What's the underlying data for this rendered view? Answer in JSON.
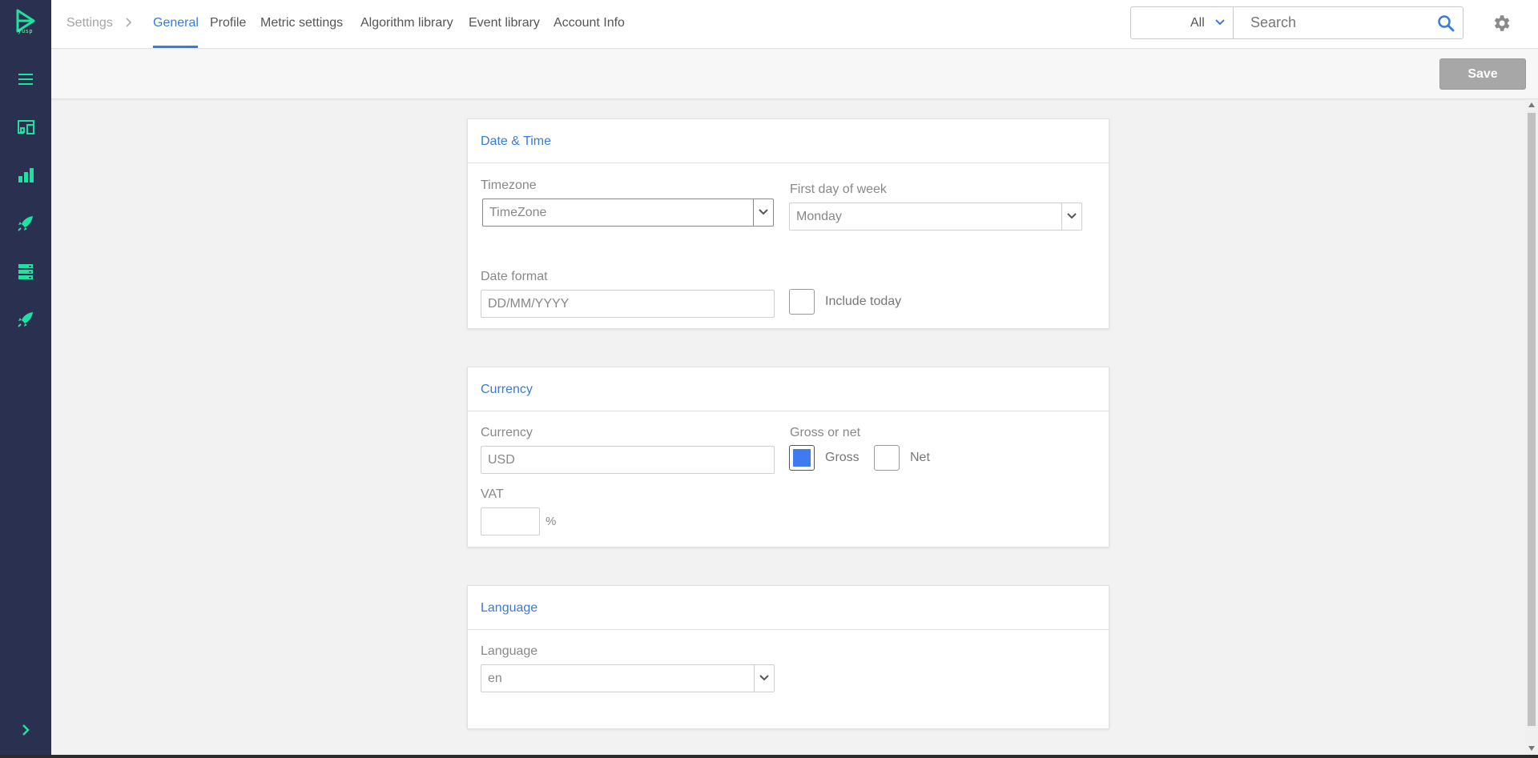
{
  "brand": {
    "logo_text": "yusp",
    "accent": "#3a7bd5",
    "sidebar_bg": "#2a3150",
    "sidebar_icon_color": "#1ee3a0"
  },
  "sidebar": {
    "items": [
      {
        "name": "menu-icon"
      },
      {
        "name": "devices-icon"
      },
      {
        "name": "bar-chart-icon"
      },
      {
        "name": "rocket-icon"
      },
      {
        "name": "server-list-icon"
      },
      {
        "name": "rocket-icon"
      }
    ],
    "expand_icon": "chevron-right-icon"
  },
  "topbar": {
    "breadcrumb": "Settings",
    "tabs": [
      {
        "label": "General",
        "active": true
      },
      {
        "label": "Profile",
        "active": false
      },
      {
        "label": "Metric settings",
        "active": false
      },
      {
        "label": "Algorithm library",
        "active": false
      },
      {
        "label": "Event library",
        "active": false
      },
      {
        "label": "Account Info",
        "active": false
      }
    ],
    "search": {
      "scope": "All",
      "placeholder": "Search"
    }
  },
  "toolbar": {
    "save_label": "Save"
  },
  "datetime": {
    "title": "Date & Time",
    "timezone_label": "Timezone",
    "timezone_value": "TimeZone",
    "first_day_label": "First day of week",
    "first_day_value": "Monday",
    "date_format_label": "Date format",
    "date_format_placeholder": "DD/MM/YYYY",
    "include_today_label": "Include today",
    "include_today_checked": false
  },
  "currency": {
    "title": "Currency",
    "currency_label": "Currency",
    "currency_value": "USD",
    "gross_net_label": "Gross or net",
    "gross_label": "Gross",
    "gross_checked": true,
    "net_label": "Net",
    "net_checked": false,
    "vat_label": "VAT",
    "vat_value": "",
    "vat_unit": "%"
  },
  "language": {
    "title": "Language",
    "language_label": "Language",
    "language_value": "en"
  }
}
